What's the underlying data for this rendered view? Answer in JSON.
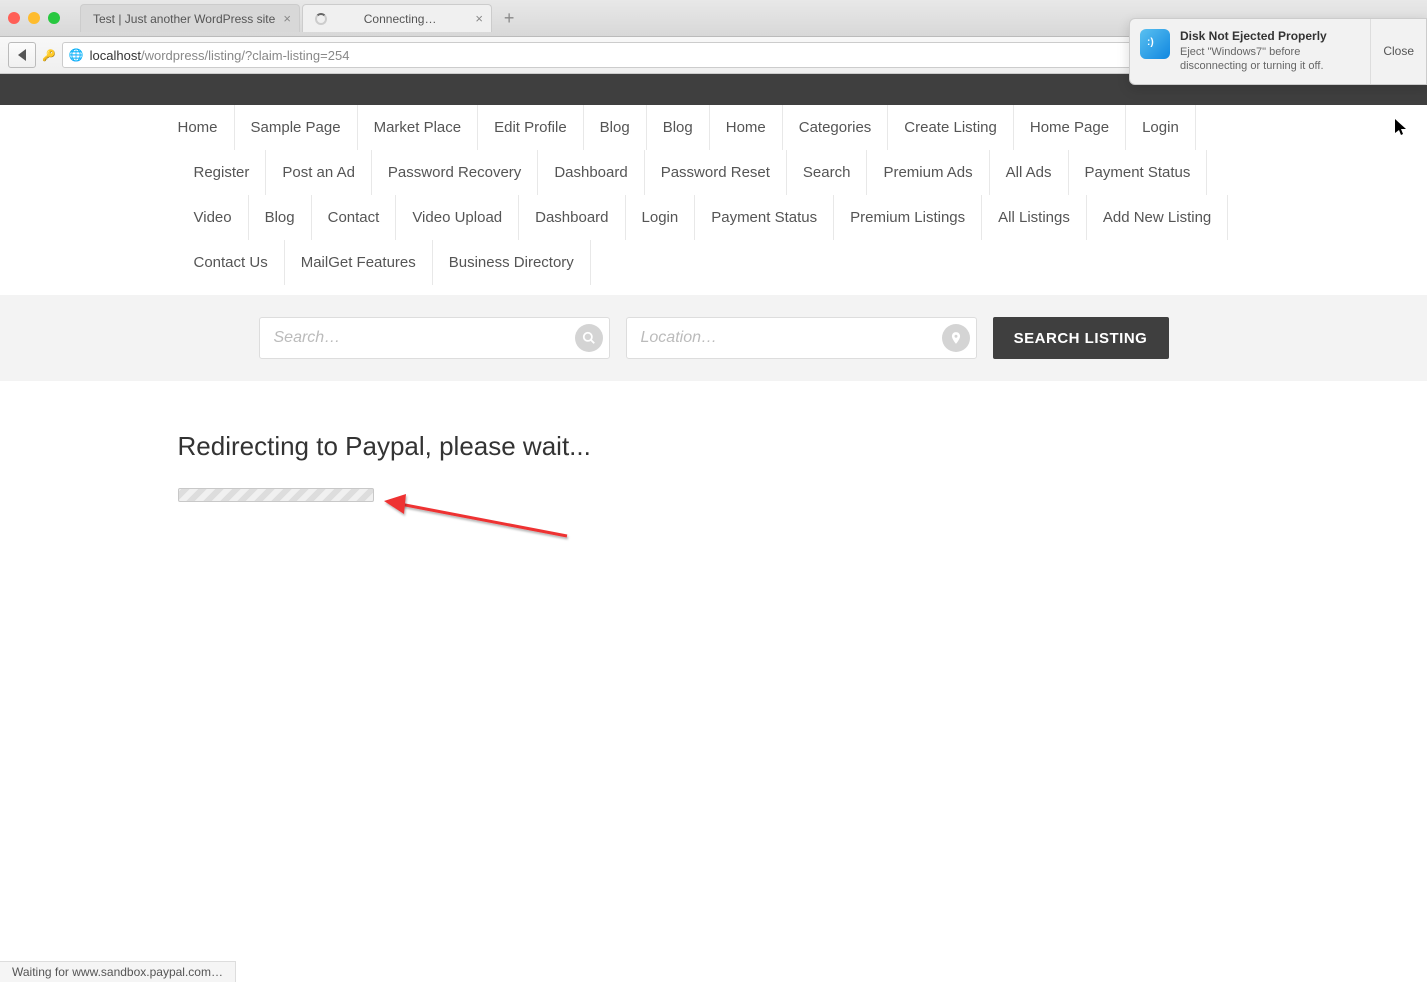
{
  "browser": {
    "tabs": [
      {
        "title": "Test | Just another WordPress site",
        "loading": false
      },
      {
        "title": "Connecting…",
        "loading": true
      }
    ],
    "url_host": "localhost",
    "url_path": "/wordpress/listing/?claim-listing=254",
    "search_placeholder": "Search"
  },
  "notification": {
    "title": "Disk Not Ejected Properly",
    "desc": "Eject \"Windows7\" before disconnecting or turning it off.",
    "close_label": "Close"
  },
  "nav": {
    "items": [
      "Home",
      "Sample Page",
      "Market Place",
      "Edit Profile",
      "Blog",
      "Blog",
      "Home",
      "Categories",
      "Create Listing",
      "Home Page",
      "Login",
      "Register",
      "Post an Ad",
      "Password Recovery",
      "Dashboard",
      "Password Reset",
      "Search",
      "Premium Ads",
      "All Ads",
      "Payment Status",
      "Video",
      "Blog",
      "Contact",
      "Video Upload",
      "Dashboard",
      "Login",
      "Payment Status",
      "Premium Listings",
      "All Listings",
      "Add New Listing",
      "Contact Us",
      "MailGet Features",
      "Business Directory"
    ]
  },
  "search_area": {
    "search_placeholder": "Search…",
    "location_placeholder": "Location…",
    "button_label": "SEARCH LISTING"
  },
  "content": {
    "heading": "Redirecting to Paypal, please wait..."
  },
  "status_bar": {
    "text": "Waiting for www.sandbox.paypal.com…"
  }
}
